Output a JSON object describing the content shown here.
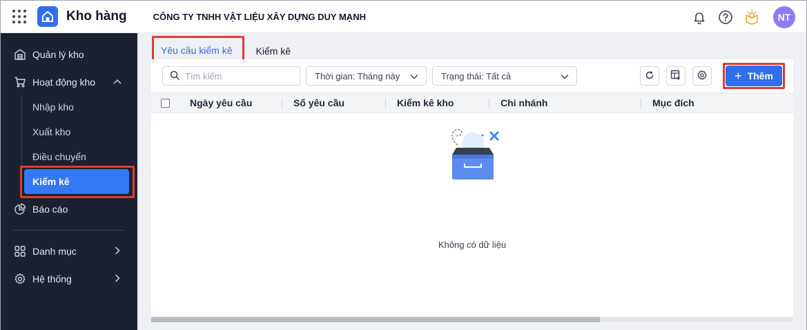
{
  "app": {
    "title": "Kho hàng",
    "company": "CÔNG TY TNHH VẬT LIỆU XÂY DỰNG DUY MẠNH"
  },
  "user": {
    "initials": "NT"
  },
  "colors": {
    "primary": "#2f6fed",
    "sidebar": "#1b2130",
    "highlight": "#e03c31",
    "avatar": "#8b7cf6",
    "tip": "#f5a623"
  },
  "sidebar": {
    "items": [
      {
        "label": "Quản lý kho",
        "icon": "warehouse-icon"
      },
      {
        "label": "Hoạt động kho",
        "icon": "cart-icon",
        "expanded": true
      },
      {
        "label": "Báo cáo",
        "icon": "pie-chart-icon"
      },
      {
        "label": "Danh mục",
        "icon": "grid-icon"
      },
      {
        "label": "Hệ thống",
        "icon": "gear-icon"
      }
    ],
    "sub_items": [
      "Nhập kho",
      "Xuất kho",
      "Điều chuyển",
      "Kiểm kê"
    ],
    "active": "Kiểm kê"
  },
  "tabs": [
    {
      "label": "Yêu cầu kiểm kê",
      "active": true
    },
    {
      "label": "Kiểm kê",
      "active": false
    }
  ],
  "toolbar": {
    "search_placeholder": "Tìm kiếm",
    "time_filter": "Thời gian: Tháng này",
    "status_filter": "Trạng thái: Tất cả",
    "add_label": "Thêm"
  },
  "table": {
    "columns": [
      "Ngày yêu cầu",
      "Số yêu cầu",
      "Kiểm kê kho",
      "Chi nhánh",
      "Mục đích"
    ],
    "empty_text": "Không có dữ liệu"
  }
}
